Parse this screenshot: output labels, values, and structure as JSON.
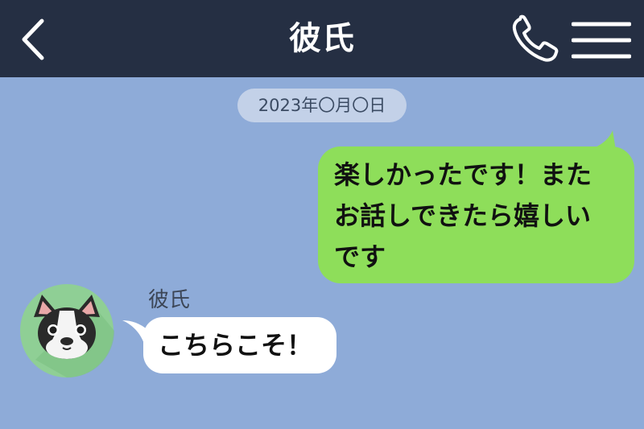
{
  "header": {
    "title": "彼氏",
    "back_icon": "chevron-left-icon",
    "call_icon": "phone-icon",
    "menu_icon": "hamburger-menu-icon"
  },
  "chat": {
    "date": "2023年〇月〇日",
    "messages": [
      {
        "direction": "outgoing",
        "text": "楽しかったです！また\nお話しできたら嬉しい\nです"
      },
      {
        "direction": "incoming",
        "sender": "彼氏",
        "text": "こちらこそ！",
        "avatar_icon": "dog-avatar-icon"
      }
    ]
  },
  "colors": {
    "header_bg": "#252f43",
    "chat_bg": "#8eabd8",
    "outgoing_bubble": "#8ede5a",
    "incoming_bubble": "#ffffff",
    "date_badge": "#c3d1e8",
    "avatar_bg": "#8fcf95"
  }
}
